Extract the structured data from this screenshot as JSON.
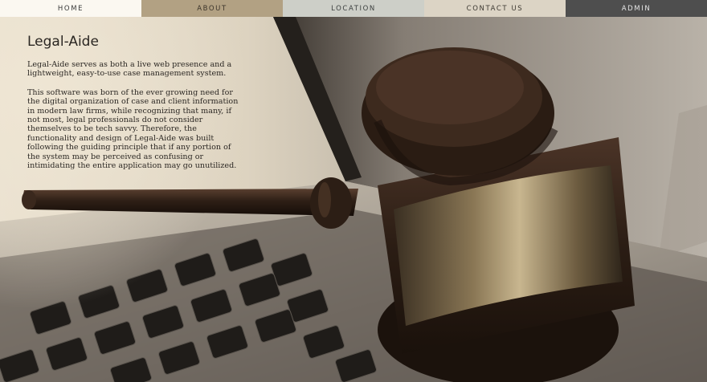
{
  "nav": {
    "items": [
      {
        "label": "HOME"
      },
      {
        "label": "ABOUT"
      },
      {
        "label": "LOCATION"
      },
      {
        "label": "CONTACT US"
      },
      {
        "label": "ADMIN"
      }
    ]
  },
  "intro": {
    "title": "Legal-Aide",
    "paragraphs": [
      "Legal-Aide serves as both a live web presence and a lightweight, easy-to-use case management system.",
      "This software was born of the ever growing need for the digital organization of case and client information in modern law firms, while recognizing that many, if not most, legal professionals do not consider themselves to be tech savvy. Therefore, the functionality and design of Legal-Aide was built following the guiding principle that if any portion of the system may be perceived as confusing or intimidating the entire application may go unutilized."
    ]
  },
  "hero": {
    "image_subject": "gavel-on-laptop",
    "colors": {
      "wood": "#2b1d14",
      "brass": "#8a7755",
      "paper": "#e8dfcd"
    }
  }
}
